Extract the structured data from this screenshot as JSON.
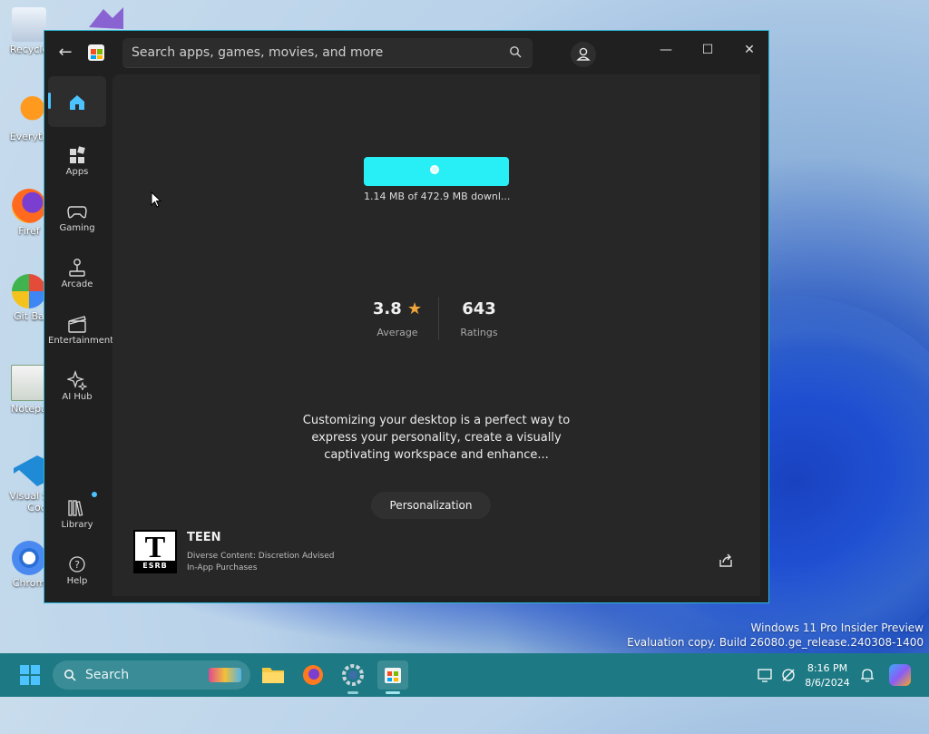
{
  "desktop": {
    "icons": [
      {
        "label": "Recycle",
        "icon": "recycle-bin-icon"
      },
      {
        "label": "Everyth",
        "icon": "everything-search-icon"
      },
      {
        "label": "Firef",
        "icon": "firefox-icon"
      },
      {
        "label": "Git Ba",
        "icon": "git-bash-icon"
      },
      {
        "label": "Notepa",
        "icon": "notepad-icon"
      },
      {
        "label": "Visual S",
        "icon": "vscode-icon"
      },
      {
        "label": "Cod",
        "icon": "vscode-icon"
      },
      {
        "label": "Chrom",
        "icon": "chrome-icon"
      }
    ],
    "watermark_line1": "Windows 11 Pro Insider Preview",
    "watermark_line2": "Evaluation copy. Build 26080.ge_release.240308-1400"
  },
  "window": {
    "search_placeholder": "Search apps, games, movies, and more",
    "controls": {
      "minimize": "—",
      "maximize": "☐",
      "close": "✕"
    }
  },
  "nav": {
    "home": {
      "label": "",
      "icon": "home-icon"
    },
    "apps": {
      "label": "Apps",
      "icon": "apps-icon"
    },
    "gaming": {
      "label": "Gaming",
      "icon": "gamepad-icon"
    },
    "arcade": {
      "label": "Arcade",
      "icon": "joystick-icon"
    },
    "entertainment": {
      "label": "Entertainment",
      "icon": "clapperboard-icon"
    },
    "ai_hub": {
      "label": "AI Hub",
      "icon": "sparkle-icon"
    },
    "library": {
      "label": "Library",
      "icon": "library-icon"
    },
    "help": {
      "label": "Help",
      "icon": "help-icon"
    }
  },
  "download": {
    "status": "1.14 MB of 472.9 MB downl...",
    "progress_fraction": 0.0024
  },
  "ratings": {
    "average_value": "3.8",
    "average_label": "Average",
    "count_value": "643",
    "count_label": "Ratings"
  },
  "description": "Customizing your desktop is a perfect way to express your personality, create a visually captivating workspace and enhance...",
  "category_tag": "Personalization",
  "esrb": {
    "badge_letter": "T",
    "badge_brand": "ESRB",
    "rating": "TEEN",
    "descriptor_1": "Diverse Content: Discretion Advised",
    "descriptor_2": "In-App Purchases"
  },
  "taskbar": {
    "search_label": "Search",
    "time": "8:16 PM",
    "date": "8/6/2024"
  },
  "colors": {
    "accent": "#27eff5",
    "window_border": "#2bb8d6",
    "rating_star": "#f0a53a",
    "taskbar": "#1d7a84"
  }
}
